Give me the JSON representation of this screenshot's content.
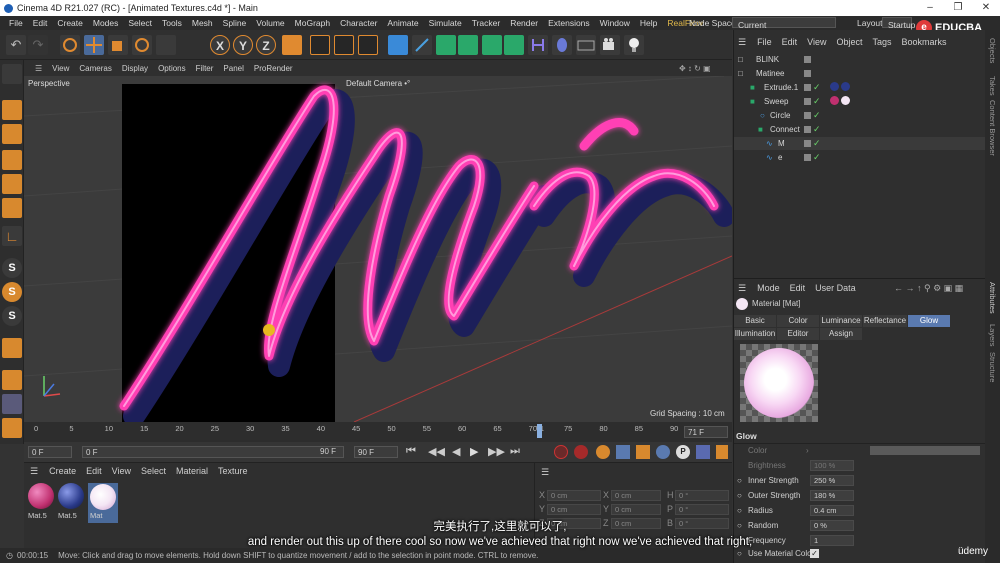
{
  "window": {
    "title": "Cinema 4D R21.027 (RC) - [Animated Textures.c4d *] - Main"
  },
  "menubar": {
    "items": [
      "File",
      "Edit",
      "Create",
      "Modes",
      "Select",
      "Tools",
      "Mesh",
      "Spline",
      "Volume",
      "MoGraph",
      "Character",
      "Animate",
      "Simulate",
      "Tracker",
      "Render",
      "Extensions",
      "Window",
      "Help",
      "RealFlow"
    ],
    "node_space_label": "Node Space:",
    "node_space_value": "Current (Standard/Physical)",
    "layout_label": "Layout:",
    "layout_value": "Startup"
  },
  "brand": {
    "name": "EDUCBA"
  },
  "viewport": {
    "menu": [
      "View",
      "Cameras",
      "Display",
      "Options",
      "Filter",
      "Panel",
      "ProRender"
    ],
    "label": "Perspective",
    "camera": "Default Camera •°",
    "grid_spacing": "Grid Spacing : 10 cm",
    "accent": "#ff3fb4"
  },
  "timeline": {
    "ticks": [
      "0",
      "5",
      "10",
      "15",
      "20",
      "25",
      "30",
      "35",
      "40",
      "45",
      "50",
      "55",
      "60",
      "65",
      "70",
      "71",
      "75",
      "80",
      "85",
      "90"
    ],
    "current_frame": "71 F"
  },
  "transport": {
    "start": "0 F",
    "min": "0 F",
    "max": "90 F",
    "end": "90 F"
  },
  "material_manager": {
    "menu": [
      "Create",
      "Edit",
      "View",
      "Select",
      "Material",
      "Texture"
    ],
    "materials": [
      {
        "name": "Mat.5",
        "color": "#c0306f"
      },
      {
        "name": "Mat.5",
        "color": "#2a3a8a"
      },
      {
        "name": "Mat",
        "color": "#f4e6f4"
      }
    ]
  },
  "coordinates": {
    "rows": [
      {
        "a": "X",
        "av": "0 cm",
        "b": "X",
        "bv": "0 cm",
        "c": "H",
        "cv": "0 °"
      },
      {
        "a": "Y",
        "av": "0 cm",
        "b": "Y",
        "bv": "0 cm",
        "c": "P",
        "cv": "0 °"
      },
      {
        "a": "Z",
        "av": "0 cm",
        "b": "Z",
        "bv": "0 cm",
        "c": "B",
        "cv": "0 °"
      }
    ]
  },
  "object_manager": {
    "menu": [
      "File",
      "Edit",
      "View",
      "Object",
      "Tags",
      "Bookmarks"
    ],
    "objects": [
      {
        "name": "BLINK",
        "depth": 0
      },
      {
        "name": "Matinee",
        "depth": 0
      },
      {
        "name": "Extrude.1",
        "depth": 1
      },
      {
        "name": "Sweep",
        "depth": 1
      },
      {
        "name": "Circle",
        "depth": 2
      },
      {
        "name": "Connect",
        "depth": 2
      },
      {
        "name": "M",
        "depth": 3
      },
      {
        "name": "e",
        "depth": 3
      }
    ]
  },
  "attribute_manager": {
    "menu": [
      "Mode",
      "Edit",
      "User Data"
    ],
    "material_title": "Material [Mat]",
    "tabs_row1": [
      "Basic",
      "Color",
      "Luminance",
      "Reflectance",
      "Glow"
    ],
    "tabs_row2": [
      "Illumination",
      "Editor",
      "Assign"
    ],
    "active_tab": "Glow",
    "section": "Glow",
    "params": [
      {
        "label": "Color",
        "value": ""
      },
      {
        "label": "Brightness",
        "value": "100 %"
      },
      {
        "label": "Inner Strength",
        "value": "250 %"
      },
      {
        "label": "Outer Strength",
        "value": "180 %"
      },
      {
        "label": "Radius",
        "value": "0.4 cm"
      },
      {
        "label": "Random",
        "value": "0 %"
      },
      {
        "label": "Frequency",
        "value": "1"
      },
      {
        "label": "Use Material Color",
        "value": ""
      }
    ]
  },
  "side_tabs": [
    "Objects",
    "Takes",
    "Content Browser",
    "Attributes",
    "Layers",
    "Structure"
  ],
  "status": {
    "time": "00:00:15",
    "message": "Move: Click and drag to move elements. Hold down SHIFT to quantize movement / add to the selection in point mode. CTRL to remove."
  },
  "subtitles": {
    "chinese": "完美执行了,这里就可以了,",
    "english": "and render out this up of there cool so now we've achieved that right now we've achieved that right,"
  },
  "watermark": {
    "text": "üdemy"
  }
}
